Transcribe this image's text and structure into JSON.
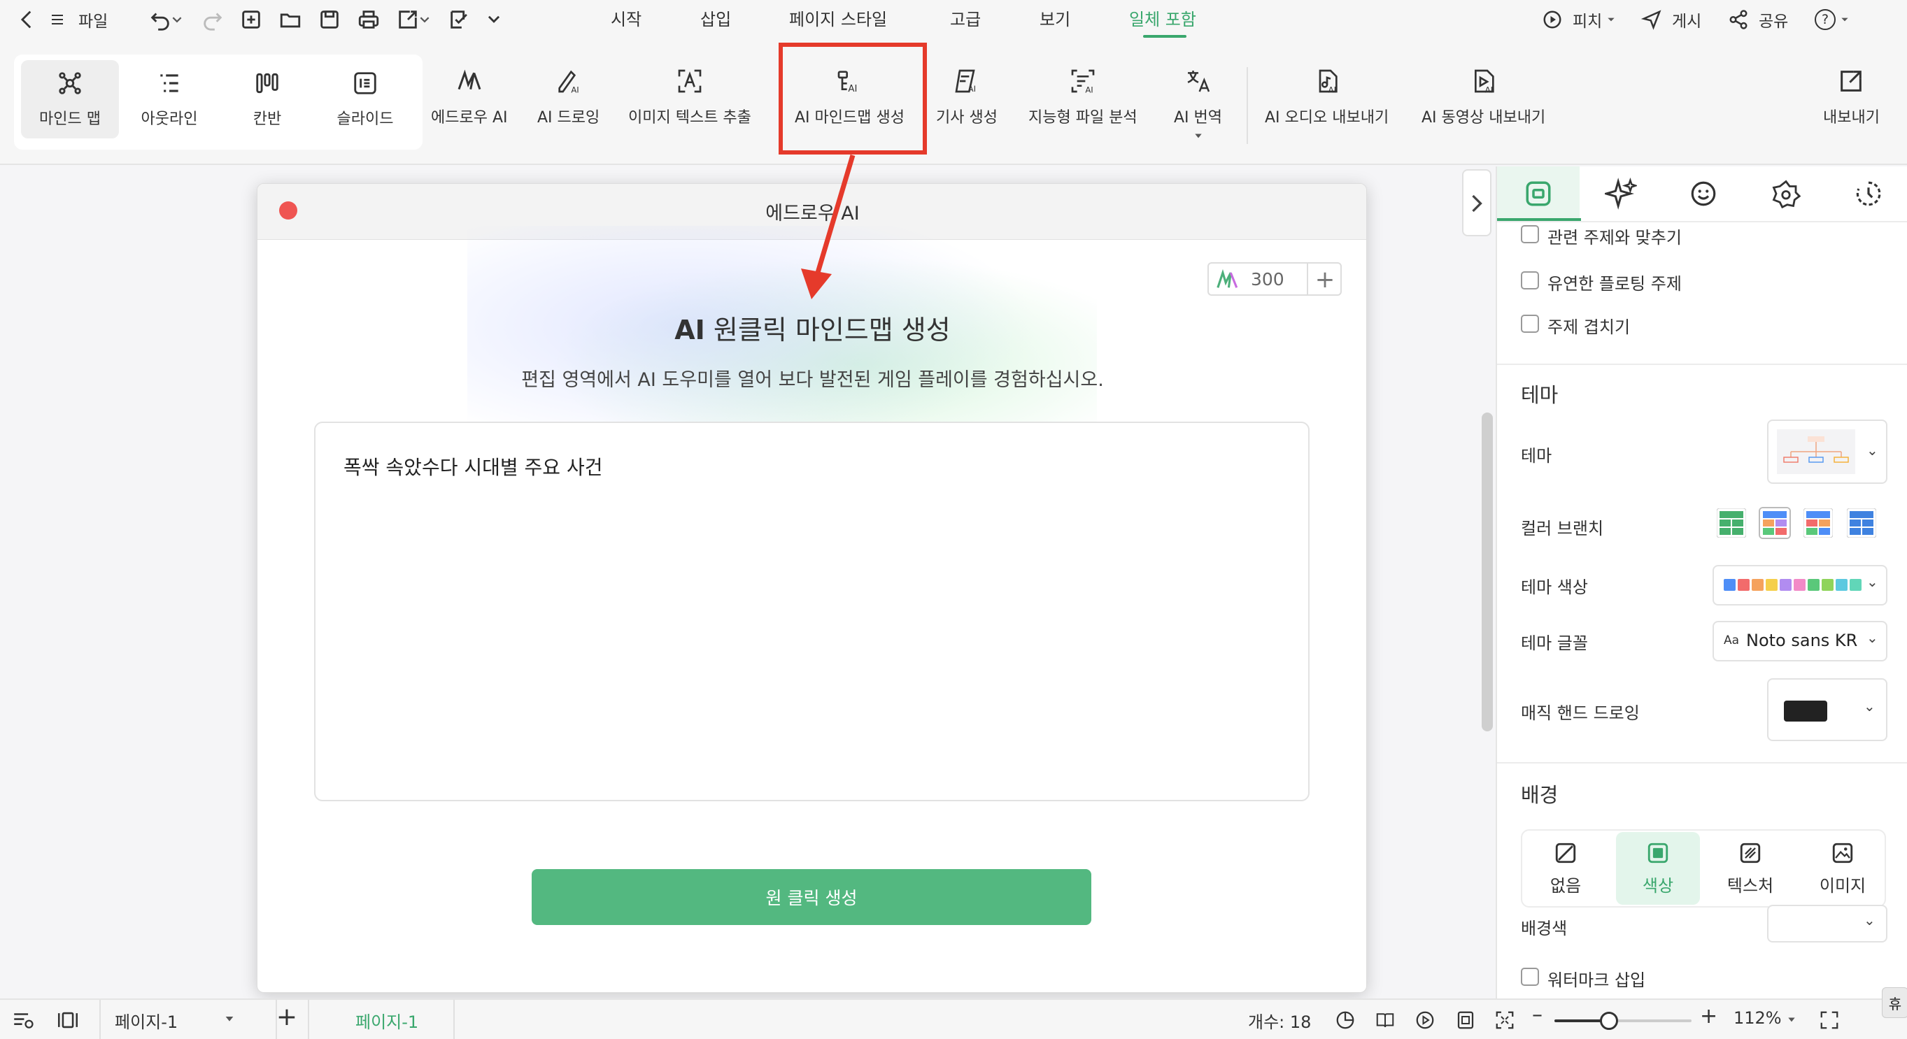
{
  "topbar": {
    "file_label": "파일",
    "menu_tabs": [
      "시작",
      "삽입",
      "페이지 스타일",
      "고급",
      "보기",
      "일체 포함"
    ],
    "active_tab": "일체 포함",
    "pitch_label": "피치",
    "publish_label": "게시",
    "share_label": "공유",
    "help_label": "?"
  },
  "ribbon": {
    "view_buttons": [
      "마인드 맵",
      "아웃라인",
      "칸반",
      "슬라이드"
    ],
    "ai_buttons": [
      "에드로우 AI",
      "AI 드로잉",
      "이미지 텍스트 추출",
      "AI 마인드맵 생성",
      "기사 생성",
      "지능형 파일 분석",
      "AI 번역"
    ],
    "export_buttons": [
      "AI 오디오 내보내기",
      "AI 동영상 내보내기"
    ],
    "export_label": "내보내기",
    "highlighted_button": "AI 마인드맵 생성"
  },
  "dialog": {
    "title": "에드로우 AI",
    "credits": "300",
    "heading_prefix": "AI",
    "heading_rest": " 원클릭 마인드맵 생성",
    "subtitle": "편집 영역에서 AI 도우미를 열어 보다 발전된 게임 플레이를 경험하십시오.",
    "prompt_text": "폭싹 속았수다 시대별 주요 사건",
    "generate_button": "원 클릭 생성"
  },
  "panel": {
    "checkboxes_top": [
      "관련 주제와 맞추기",
      "유연한 플로팅 주제",
      "주제 겹치기"
    ],
    "theme_section": "테마",
    "theme_label": "테마",
    "color_branch_label": "컬러 브랜치",
    "theme_color_label": "테마 색상",
    "theme_font_label": "테마 글꼴",
    "theme_font_value": "Noto sans KR",
    "font_icon": "Aa",
    "hand_drawing_label": "매직 핸드 드로잉",
    "background_section": "배경",
    "bg_options": [
      "없음",
      "색상",
      "텍스처",
      "이미지"
    ],
    "bg_active": "색상",
    "bg_color_label": "배경색",
    "watermark_label": "워터마크 삽입",
    "theme_swatches": [
      "#4e8ef7",
      "#f26b6b",
      "#f5a25d",
      "#f5cf4b",
      "#b18cf0",
      "#f28ac7",
      "#5ac87a",
      "#8fd45a",
      "#5cc9e0",
      "#61d6b8"
    ],
    "hand_drawing_color": "#222222"
  },
  "statusbar": {
    "page_select": "페이지-1",
    "page_tab": "페이지-1",
    "count_label": "개수: 18",
    "zoom": "112%",
    "tooltip_stub": "휴"
  },
  "colors": {
    "accent": "#3aa76d",
    "highlight": "#e53a2b",
    "button": "#53b880"
  }
}
